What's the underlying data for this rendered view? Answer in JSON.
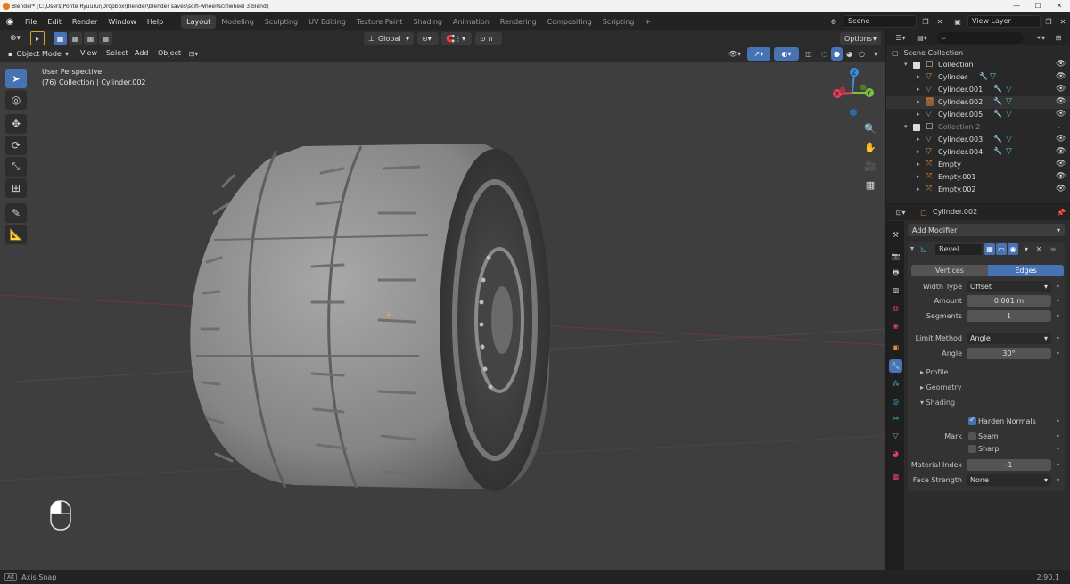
{
  "titlebar": {
    "title": "Blender* [C:\\Users\\Ponte Ryuurui\\Dropbox\\Blender\\blender saves\\scifi-wheel\\scifiwheel 3.blend]",
    "min": "—",
    "max": "☐",
    "close": "✕"
  },
  "menus": [
    "File",
    "Edit",
    "Render",
    "Window",
    "Help"
  ],
  "workspaces": [
    "Layout",
    "Modeling",
    "Sculpting",
    "UV Editing",
    "Texture Paint",
    "Shading",
    "Animation",
    "Rendering",
    "Compositing",
    "Scripting"
  ],
  "add_workspace": "+",
  "scene": {
    "name": "Scene"
  },
  "view_layer": {
    "name": "View Layer"
  },
  "header": {
    "transform_orientation": "Global",
    "options": "Options",
    "mode": "Object Mode",
    "menus": [
      "View",
      "Select",
      "Add",
      "Object"
    ]
  },
  "viewport": {
    "perspective": "User Perspective",
    "collection_info": "(76) Collection | Cylinder.002"
  },
  "gizmo": {
    "z": "Z",
    "y": "Y",
    "x": "X"
  },
  "outliner": {
    "title": "Scene Collection",
    "items": [
      {
        "label": "Collection",
        "type": "collection",
        "level": 1
      },
      {
        "label": "Cylinder",
        "type": "mesh",
        "level": 2
      },
      {
        "label": "Cylinder.001",
        "type": "mesh",
        "level": 2
      },
      {
        "label": "Cylinder.002",
        "type": "mesh",
        "level": 2,
        "active": true
      },
      {
        "label": "Cylinder.005",
        "type": "mesh",
        "level": 2
      },
      {
        "label": "Collection 2",
        "type": "collection",
        "level": 1
      },
      {
        "label": "Cylinder.003",
        "type": "mesh",
        "level": 2
      },
      {
        "label": "Cylinder.004",
        "type": "mesh",
        "level": 2
      },
      {
        "label": "Empty",
        "type": "empty",
        "level": 2
      },
      {
        "label": "Empty.001",
        "type": "empty",
        "level": 2
      },
      {
        "label": "Empty.002",
        "type": "empty",
        "level": 2
      }
    ]
  },
  "properties": {
    "object_name": "Cylinder.002",
    "add_modifier": "Add Modifier",
    "modifier_name": "Bevel",
    "tabs": {
      "vertices": "Vertices",
      "edges": "Edges"
    },
    "width_type": {
      "label": "Width Type",
      "value": "Offset"
    },
    "amount": {
      "label": "Amount",
      "value": "0.001 m"
    },
    "segments": {
      "label": "Segments",
      "value": "1"
    },
    "limit_method": {
      "label": "Limit Method",
      "value": "Angle"
    },
    "angle": {
      "label": "Angle",
      "value": "30°"
    },
    "sections": {
      "profile": "Profile",
      "geometry": "Geometry",
      "shading": "Shading"
    },
    "harden_normals": {
      "label": "Harden Normals",
      "checked": true
    },
    "mark": {
      "label": "Mark",
      "seam": "Seam",
      "sharp": "Sharp",
      "seam_checked": false,
      "sharp_checked": false
    },
    "material_index": {
      "label": "Material Index",
      "value": "-1"
    },
    "face_strength": {
      "label": "Face Strength",
      "value": "None"
    }
  },
  "status": {
    "key": "Alt",
    "text": "Axis Snap",
    "version": "2.90.1"
  },
  "colors": {
    "accent": "#4772b3",
    "mesh": "#e08a3c",
    "modifier": "#3cb4e6",
    "data": "#4ed0a0",
    "x": "#e0405a",
    "y": "#7ac142",
    "z": "#3b8fe0"
  }
}
